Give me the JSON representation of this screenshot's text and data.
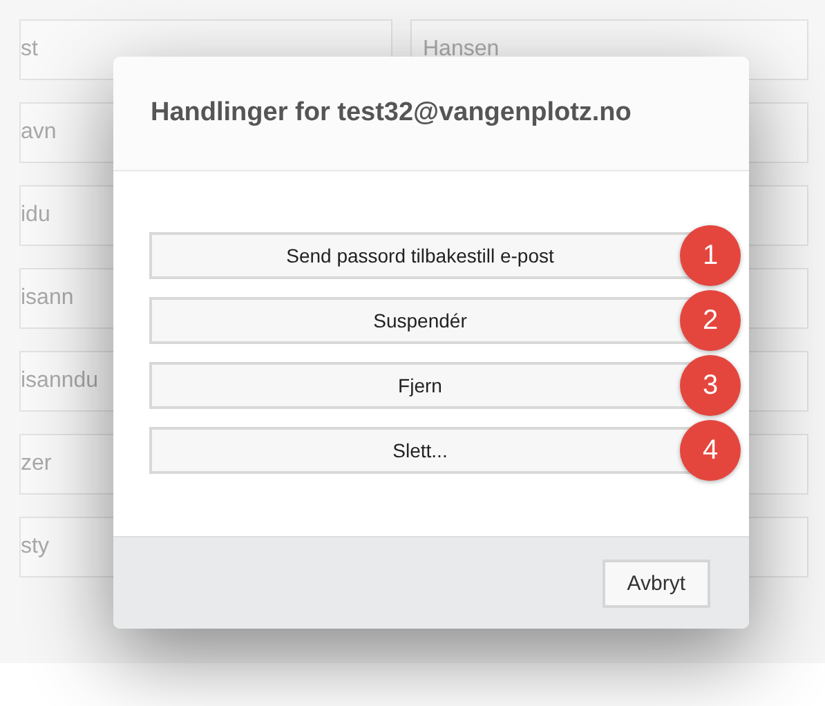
{
  "background_rows": [
    {
      "left": "st",
      "right": "Hansen"
    },
    {
      "left": "avn"
    },
    {
      "left": "idu"
    },
    {
      "left": "isann"
    },
    {
      "left": "isanndu"
    },
    {
      "left": "zer"
    },
    {
      "left": "sty"
    }
  ],
  "dialog": {
    "title": "Handlinger for test32@vangenplotz.no",
    "actions": [
      {
        "label": "Send passord tilbakestill e-post",
        "badge": "1"
      },
      {
        "label": "Suspendér",
        "badge": "2"
      },
      {
        "label": "Fjern",
        "badge": "3"
      },
      {
        "label": "Slett...",
        "badge": "4"
      }
    ],
    "buttons": [
      "Avbryt"
    ]
  }
}
